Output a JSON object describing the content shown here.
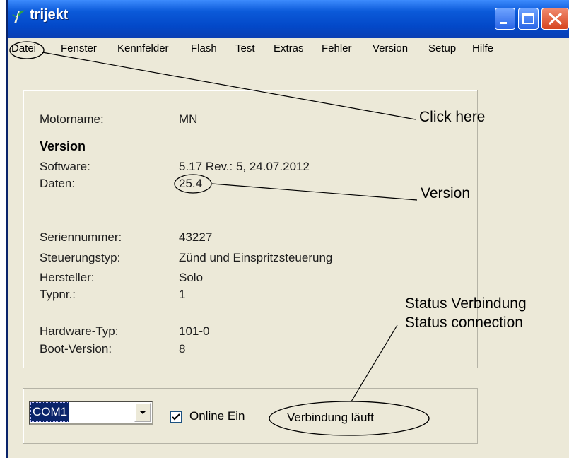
{
  "window": {
    "title": "trijekt",
    "caption_buttons": [
      "minimize-icon",
      "maximize-icon",
      "close-icon"
    ]
  },
  "menu": [
    "Datei",
    "Fenster",
    "Kennfelder",
    "Flash",
    "Test",
    "Extras",
    "Fehler",
    "Version",
    "Setup",
    "Hilfe"
  ],
  "info": {
    "motorname_label": "Motorname:",
    "motorname_value": "MN",
    "version_heading": "Version",
    "software_label": "Software:",
    "software_value": "5.17 Rev.: 5, 24.07.2012",
    "daten_label": "Daten:",
    "daten_value": "25.4",
    "seriennummer_label": "Seriennummer:",
    "seriennummer_value": "43227",
    "steuerungstyp_label": "Steuerungstyp:",
    "steuerungstyp_value": "Zünd und Einspritzsteuerung",
    "hersteller_label": "Hersteller:",
    "hersteller_value": "Solo",
    "typnr_label": "Typnr.:",
    "typnr_value": "1",
    "hardware_label": "Hardware-Typ:",
    "hardware_value": "101-0",
    "boot_label": "Boot-Version:",
    "boot_value": "8"
  },
  "connection": {
    "port": "COM1",
    "online_label": "Online Ein",
    "online_checked": true,
    "status": "Verbindung läuft"
  },
  "annotations": {
    "click_here": "Click here",
    "version": "Version",
    "status_de": "Status Verbindung",
    "status_en": "Status connection"
  }
}
